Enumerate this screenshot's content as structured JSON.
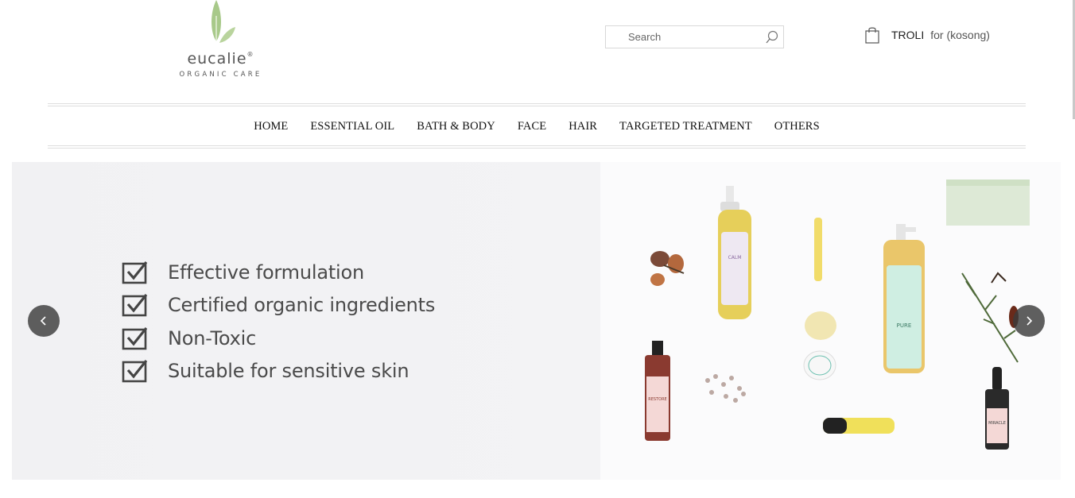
{
  "brand": {
    "name": "eucalie",
    "registered": "®",
    "tagline": "ORGANIC CARE",
    "leaf_color": "#a8c98a"
  },
  "search": {
    "placeholder": "Search"
  },
  "cart": {
    "label": "TROLI",
    "status": "for (kosong)"
  },
  "nav": {
    "items": [
      {
        "label": "HOME"
      },
      {
        "label": "ESSENTIAL OIL"
      },
      {
        "label": "BATH & BODY"
      },
      {
        "label": "FACE"
      },
      {
        "label": "HAIR"
      },
      {
        "label": "TARGETED TREATMENT"
      },
      {
        "label": "OTHERS"
      }
    ]
  },
  "banner": {
    "features": [
      {
        "text": "Effective formulation"
      },
      {
        "text": "Certified organic ingredients"
      },
      {
        "text": "Non-Toxic"
      },
      {
        "text": "Suitable for sensitive skin"
      }
    ],
    "products": [
      {
        "label": "CALM"
      },
      {
        "label": "PURE"
      },
      {
        "label": "RESTORE"
      },
      {
        "label": "MIRACLE"
      }
    ]
  }
}
